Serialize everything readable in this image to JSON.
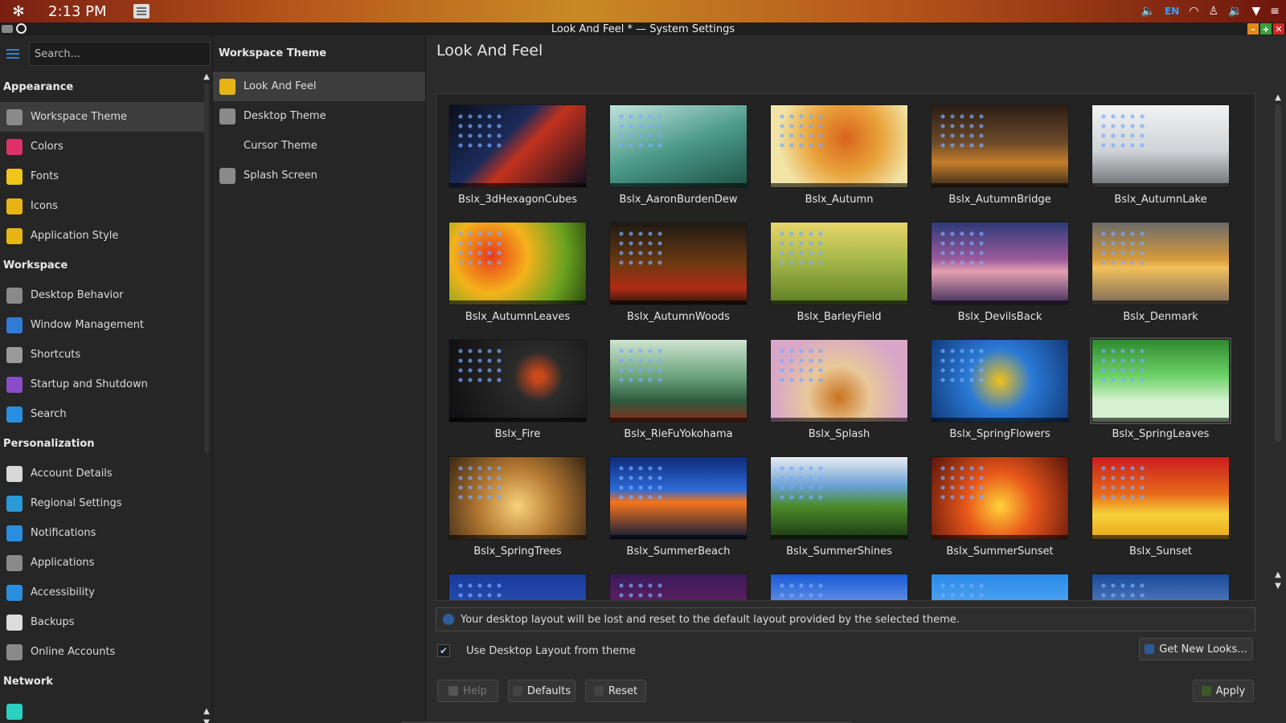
{
  "panel": {
    "clock": "2:13 PM",
    "keyboard_layout": "EN"
  },
  "window": {
    "title": "Look And Feel * — System Settings"
  },
  "sidebar": {
    "search_placeholder": "Search...",
    "categories": [
      {
        "label": "Appearance",
        "items": [
          {
            "label": "Workspace Theme",
            "icon": "workspace-theme-icon",
            "color": "#8a8a8a",
            "selected": true
          },
          {
            "label": "Colors",
            "icon": "colors-icon",
            "color": "#e0306a"
          },
          {
            "label": "Fonts",
            "icon": "fonts-icon",
            "color": "#f0c419"
          },
          {
            "label": "Icons",
            "icon": "icons-icon",
            "color": "#e7b416"
          },
          {
            "label": "Application Style",
            "icon": "application-style-icon",
            "color": "#e7b416"
          }
        ]
      },
      {
        "label": "Workspace",
        "items": [
          {
            "label": "Desktop Behavior",
            "icon": "desktop-behavior-icon",
            "color": "#8a8a8a"
          },
          {
            "label": "Window Management",
            "icon": "window-management-icon",
            "color": "#2f7bd6"
          },
          {
            "label": "Shortcuts",
            "icon": "shortcuts-icon",
            "color": "#9a9a9a"
          },
          {
            "label": "Startup and Shutdown",
            "icon": "startup-shutdown-icon",
            "color": "#8b4cc9"
          },
          {
            "label": "Search",
            "icon": "search-icon",
            "color": "#2a8ee0"
          }
        ]
      },
      {
        "label": "Personalization",
        "items": [
          {
            "label": "Account Details",
            "icon": "account-details-icon",
            "color": "#d8d8d8"
          },
          {
            "label": "Regional Settings",
            "icon": "regional-settings-icon",
            "color": "#2a9ad8"
          },
          {
            "label": "Notifications",
            "icon": "notifications-icon",
            "color": "#2a8ee0"
          },
          {
            "label": "Applications",
            "icon": "applications-icon",
            "color": "#8a8a8a"
          },
          {
            "label": "Accessibility",
            "icon": "accessibility-icon",
            "color": "#2a8ee0"
          },
          {
            "label": "Backups",
            "icon": "backups-icon",
            "color": "#dcdcdc"
          },
          {
            "label": "Online Accounts",
            "icon": "online-accounts-icon",
            "color": "#8a8a8a"
          }
        ]
      },
      {
        "label": "Network",
        "items": []
      }
    ]
  },
  "midcol": {
    "header": "Workspace Theme",
    "items": [
      {
        "label": "Look And Feel",
        "icon": "look-and-feel-icon",
        "color": "#e7b416",
        "selected": true
      },
      {
        "label": "Desktop Theme",
        "icon": "desktop-theme-icon",
        "color": "#8a8a8a"
      },
      {
        "label": "Cursor Theme",
        "icon": "",
        "color": ""
      },
      {
        "label": "Splash Screen",
        "icon": "splash-screen-icon",
        "color": "#8a8a8a"
      }
    ]
  },
  "main": {
    "title": "Look And Feel",
    "themes": [
      {
        "name": "Bslx_3dHexagonCubes",
        "bg": "linear-gradient(135deg,#0b0f1c,#1b2b5a 40%,#c2321e 55%,#101020)"
      },
      {
        "name": "Bslx_AaronBurdenDew",
        "bg": "linear-gradient(160deg,#bfe3dc,#4c9a8a 50%,#1d5245)"
      },
      {
        "name": "Bslx_Autumn",
        "bg": "radial-gradient(circle at 55% 40%,#d8641c,#e9a33b 40%,#f1e4a6 75%)"
      },
      {
        "name": "Bslx_AutumnBridge",
        "bg": "linear-gradient(180deg,#2a1d14,#6b4a2a 45%,#c57d2b 70%,#3a2a1a)"
      },
      {
        "name": "Bslx_AutumnLake",
        "bg": "linear-gradient(180deg,#f2f2f2,#cfd4d8 55%,#6c6f72)"
      },
      {
        "name": "Bslx_AutumnLeaves",
        "bg": "radial-gradient(circle at 30% 40%,#e83a1a,#f4b21b 35%,#6aa21f 70%,#2b4a0f)"
      },
      {
        "name": "Bslx_AutumnWoods",
        "bg": "linear-gradient(180deg,#1d1a14,#6d3a12 50%,#b02a15 80%,#2d1a0d)"
      },
      {
        "name": "Bslx_BarleyField",
        "bg": "linear-gradient(180deg,#e8d56a,#a7b84a 45%,#5d7f23)"
      },
      {
        "name": "Bslx_DevilsBack",
        "bg": "linear-gradient(180deg,#2e3a78,#9c5a9a 45%,#e4a0b0 60%,#3d2c5a)"
      },
      {
        "name": "Bslx_Denmark",
        "bg": "linear-gradient(180deg,#6b6a6a,#d79a3c 45%,#f2c15b 55%,#7c6a5a)"
      },
      {
        "name": "Bslx_Fire",
        "bg": "radial-gradient(circle at 65% 45%,#c9481c 5%,#2b2b2b 25%,#0e0e10)"
      },
      {
        "name": "Bslx_RieFuYokohama",
        "bg": "linear-gradient(180deg,#cfe4d0,#6aa27c 45%,#2d5a3d 75%,#8a2a1a)"
      },
      {
        "name": "Bslx_Splash",
        "bg": "radial-gradient(circle at 50% 70%,#c9741e,#e9c89a 35%,#d8a7c8 75%)"
      },
      {
        "name": "Bslx_SpringFlowers",
        "bg": "radial-gradient(circle at 50% 50%,#f2c21b,#2a7ad6 40%,#123a7a)"
      },
      {
        "name": "Bslx_SpringLeaves",
        "bg": "linear-gradient(180deg,#2f8a2f,#6fd36a 45%,#d6f2d0 75%)",
        "selected": true
      },
      {
        "name": "Bslx_SpringTrees",
        "bg": "radial-gradient(circle at 50% 60%,#f8d27a,#b57a33 45%,#3a2614)"
      },
      {
        "name": "Bslx_SummerBeach",
        "bg": "linear-gradient(180deg,#0d2a7a,#2c6ad6 40%,#f5741b 55%,#0b1a3a)"
      },
      {
        "name": "Bslx_SummerShines",
        "bg": "linear-gradient(180deg,#e8ecf0,#6aa1d6 35%,#4a8a2a 60%,#1d3a12)"
      },
      {
        "name": "Bslx_SummerSunset",
        "bg": "radial-gradient(circle at 50% 60%,#ffd23a,#e8571a 40%,#5a150c)"
      },
      {
        "name": "Bslx_Sunset",
        "bg": "linear-gradient(180deg,#c81e1e,#e86a1a 45%,#f6d23a 70%,#e8a71a)"
      },
      {
        "name": "",
        "bg": "linear-gradient(180deg,#1a3a9a,#3a6ad6)"
      },
      {
        "name": "",
        "bg": "linear-gradient(180deg,#3a1a5a,#9a2a6a)"
      },
      {
        "name": "",
        "bg": "linear-gradient(180deg,#1a5ad6,#e8f0ff)"
      },
      {
        "name": "",
        "bg": "linear-gradient(180deg,#2a8ae8,#8ad0ff)"
      },
      {
        "name": "",
        "bg": "linear-gradient(180deg,#1a4a9a,#aac8e8)"
      }
    ],
    "notice": "Your desktop layout will be lost and reset to the default layout provided by the selected theme.",
    "use_layout_label": "Use Desktop Layout from theme",
    "use_layout_checked": true,
    "get_new_label": "Get New Looks...",
    "help_label": "Help",
    "defaults_label": "Defaults",
    "reset_label": "Reset",
    "apply_label": "Apply"
  }
}
